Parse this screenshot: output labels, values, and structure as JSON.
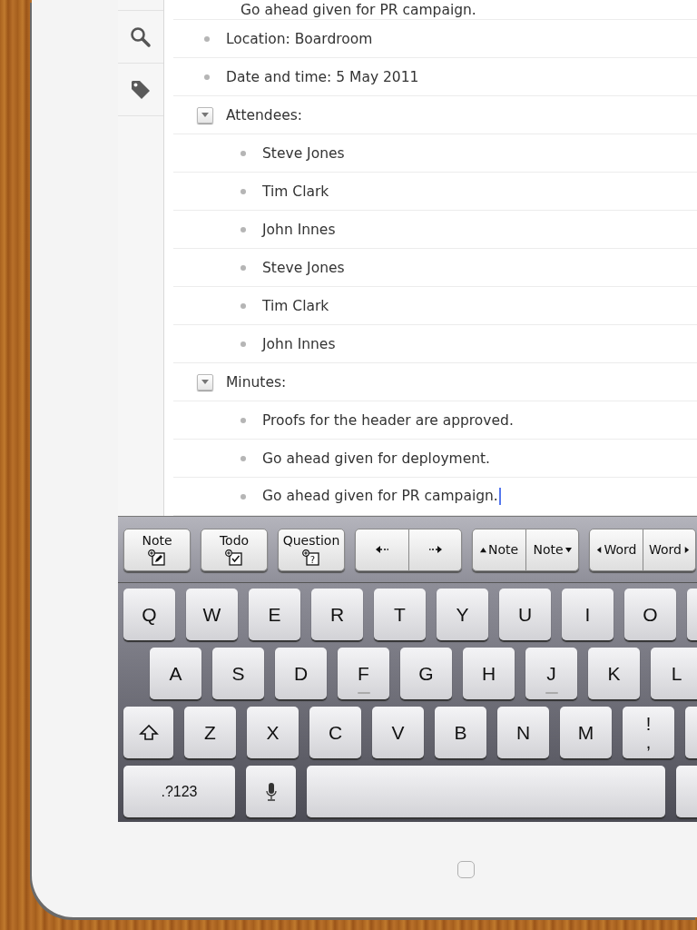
{
  "sidebar": {
    "items": [
      {
        "kind": "blank"
      },
      {
        "kind": "search"
      },
      {
        "kind": "tag"
      }
    ]
  },
  "outline": {
    "top_item": {
      "text": "Go ahead given for PR campaign.",
      "cursor": false
    },
    "items": [
      {
        "text": "Location: Boardroom",
        "kind": "bullet",
        "cursor": false
      },
      {
        "text": "Date and time: 5 May 2011",
        "kind": "bullet",
        "cursor": false
      },
      {
        "text": "Attendees:",
        "kind": "group",
        "expanded": true,
        "cursor": false,
        "children": [
          {
            "text": "Steve Jones",
            "kind": "bullet",
            "cursor": false
          },
          {
            "text": "Tim Clark",
            "kind": "bullet",
            "cursor": false
          },
          {
            "text": "John Innes",
            "kind": "bullet",
            "cursor": false
          },
          {
            "text": "Steve Jones",
            "kind": "bullet",
            "cursor": false
          },
          {
            "text": "Tim Clark",
            "kind": "bullet",
            "cursor": false
          },
          {
            "text": "John Innes",
            "kind": "bullet",
            "cursor": false
          }
        ]
      },
      {
        "text": "Minutes:",
        "kind": "group",
        "expanded": true,
        "cursor": false,
        "children": [
          {
            "text": "Proofs for the header are approved.",
            "kind": "bullet",
            "cursor": false
          },
          {
            "text": "Go ahead given for deployment.",
            "kind": "bullet",
            "cursor": false
          },
          {
            "text": "Go ahead given for PR campaign.",
            "kind": "bullet",
            "cursor": true
          }
        ]
      }
    ]
  },
  "toolbar": {
    "groups": [
      {
        "buttons": [
          {
            "kind": "note",
            "label": "Note"
          }
        ]
      },
      {
        "buttons": [
          {
            "kind": "todo",
            "label": "Todo"
          }
        ]
      },
      {
        "buttons": [
          {
            "kind": "question",
            "label": "Question",
            "icon_text": "?"
          }
        ]
      },
      {
        "buttons": [
          {
            "kind": "arrow-left"
          },
          {
            "kind": "arrow-right"
          }
        ]
      },
      {
        "buttons": [
          {
            "kind": "up",
            "label": "Note"
          },
          {
            "kind": "down",
            "label": "Note"
          }
        ]
      },
      {
        "buttons": [
          {
            "kind": "left",
            "label": "Word"
          },
          {
            "kind": "right",
            "label": "Word"
          }
        ]
      }
    ]
  },
  "keyboard": {
    "rows": [
      [
        {
          "kind": "letter",
          "label": "Q",
          "homing": false
        },
        {
          "kind": "letter",
          "label": "W",
          "homing": false
        },
        {
          "kind": "letter",
          "label": "E",
          "homing": false
        },
        {
          "kind": "letter",
          "label": "R",
          "homing": false
        },
        {
          "kind": "letter",
          "label": "T",
          "homing": false
        },
        {
          "kind": "letter",
          "label": "Y",
          "homing": false
        },
        {
          "kind": "letter",
          "label": "U",
          "homing": false
        },
        {
          "kind": "letter",
          "label": "I",
          "homing": false
        },
        {
          "kind": "letter",
          "label": "O",
          "homing": false
        },
        {
          "kind": "cut"
        }
      ],
      [
        {
          "kind": "letter",
          "label": "A",
          "homing": false
        },
        {
          "kind": "letter",
          "label": "S",
          "homing": false
        },
        {
          "kind": "letter",
          "label": "D",
          "homing": false
        },
        {
          "kind": "letter",
          "label": "F",
          "homing": true
        },
        {
          "kind": "letter",
          "label": "G",
          "homing": false
        },
        {
          "kind": "letter",
          "label": "H",
          "homing": false
        },
        {
          "kind": "letter",
          "label": "J",
          "homing": true
        },
        {
          "kind": "letter",
          "label": "K",
          "homing": false
        },
        {
          "kind": "letter",
          "label": "L",
          "homing": false
        }
      ],
      [
        {
          "kind": "shift",
          "homing": false
        },
        {
          "kind": "letter",
          "label": "Z",
          "homing": false
        },
        {
          "kind": "letter",
          "label": "X",
          "homing": false
        },
        {
          "kind": "letter",
          "label": "C",
          "homing": false
        },
        {
          "kind": "letter",
          "label": "V",
          "homing": false
        },
        {
          "kind": "letter",
          "label": "B",
          "homing": false
        },
        {
          "kind": "letter",
          "label": "N",
          "homing": false
        },
        {
          "kind": "letter",
          "label": "M",
          "homing": false
        },
        {
          "kind": "double",
          "label": "!",
          "label2": ",",
          "homing": false
        },
        {
          "kind": "cut"
        }
      ],
      [
        {
          "kind": "wide",
          "label": ".?123",
          "homing": false
        },
        {
          "kind": "mic",
          "homing": false
        },
        {
          "kind": "space",
          "homing": false
        },
        {
          "kind": "cut"
        }
      ]
    ]
  }
}
